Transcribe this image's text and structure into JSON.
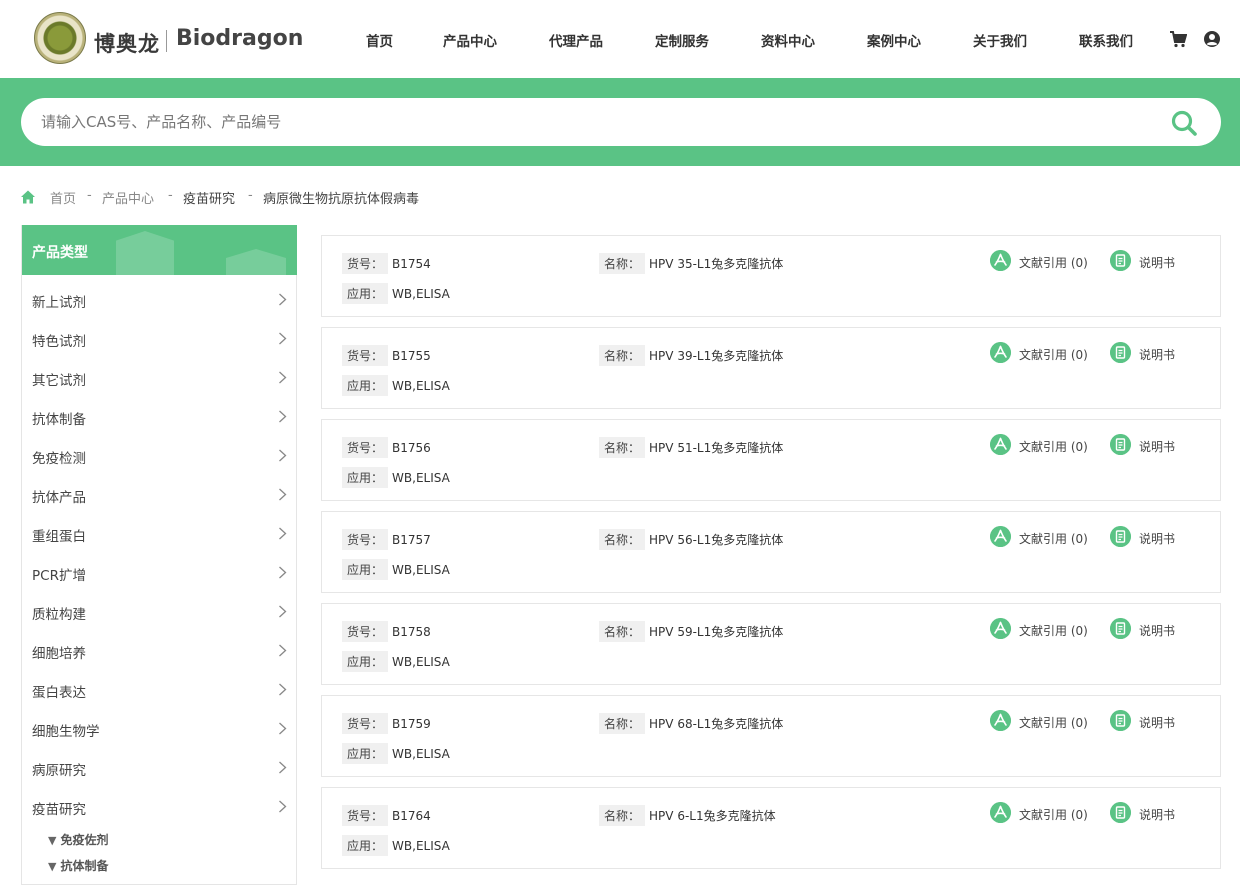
{
  "header": {
    "brand_cn": "博奥龙",
    "brand_en": "Biodragon",
    "logo_text": "BIODRAGON",
    "nav": [
      "首页",
      "产品中心",
      "代理产品",
      "定制服务",
      "资料中心",
      "案例中心",
      "关于我们",
      "联系我们"
    ]
  },
  "search": {
    "placeholder": "请输入CAS号、产品名称、产品编号"
  },
  "breadcrumb": {
    "items": [
      "首页",
      "产品中心",
      "疫苗研究",
      "病原微生物抗原抗体假病毒"
    ],
    "separator": "-"
  },
  "sidebar": {
    "title": "产品类型",
    "items": [
      "新上试剂",
      "特色试剂",
      "其它试剂",
      "抗体制备",
      "免疫检测",
      "抗体产品",
      "重组蛋白",
      "PCR扩增",
      "质粒构建",
      "细胞培养",
      "蛋白表达",
      "细胞生物学",
      "病原研究",
      "疫苗研究"
    ],
    "sub_items": [
      "免疫佐剂",
      "抗体制备"
    ],
    "sub_marker": "▼"
  },
  "labels": {
    "code": "货号",
    "name": "名称",
    "application": "应用",
    "colon": "：",
    "manual": "说明书"
  },
  "products": [
    {
      "code": "B1754",
      "name": "HPV 35-L1兔多克隆抗体",
      "application": "WB,ELISA",
      "citation": "文献引用 (0)"
    },
    {
      "code": "B1755",
      "name": "HPV 39-L1兔多克隆抗体",
      "application": "WB,ELISA",
      "citation": "文献引用 (0)"
    },
    {
      "code": "B1756",
      "name": "HPV 51-L1兔多克隆抗体",
      "application": "WB,ELISA",
      "citation": "文献引用 (0)"
    },
    {
      "code": "B1757",
      "name": "HPV 56-L1兔多克隆抗体",
      "application": "WB,ELISA",
      "citation": "文献引用 (0)"
    },
    {
      "code": "B1758",
      "name": "HPV 59-L1兔多克隆抗体",
      "application": "WB,ELISA",
      "citation": "文献引用 (0)"
    },
    {
      "code": "B1759",
      "name": "HPV 68-L1兔多克隆抗体",
      "application": "WB,ELISA",
      "citation": "文献引用 (0)"
    },
    {
      "code": "B1764",
      "name": "HPV 6-L1兔多克隆抗体",
      "application": "WB,ELISA",
      "citation": "文献引用 (0)"
    }
  ],
  "colors": {
    "accent": "#5ac385",
    "text": "#333333"
  },
  "icons": [
    "cart-icon",
    "user-icon",
    "search-icon",
    "home-icon",
    "chevron-right-icon",
    "pdf-icon",
    "document-icon"
  ]
}
